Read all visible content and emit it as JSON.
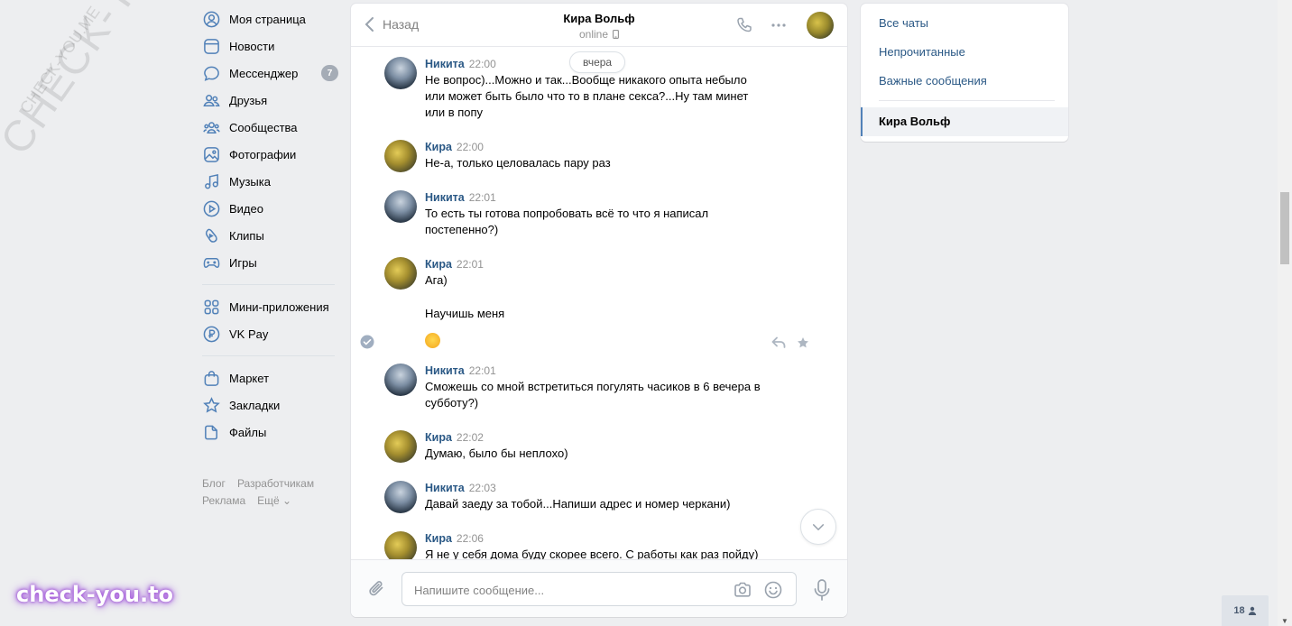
{
  "watermarks": {
    "big": "CHECK-YOU.ME",
    "small": "CHECK-YOU.ME",
    "bottom": "check-you.to"
  },
  "sidebar": {
    "items": [
      {
        "label": "Моя страница",
        "icon": "user-icon"
      },
      {
        "label": "Новости",
        "icon": "news-icon"
      },
      {
        "label": "Мессенджер",
        "icon": "messenger-icon",
        "badge": "7"
      },
      {
        "label": "Друзья",
        "icon": "friends-icon"
      },
      {
        "label": "Сообщества",
        "icon": "communities-icon"
      },
      {
        "label": "Фотографии",
        "icon": "photos-icon"
      },
      {
        "label": "Музыка",
        "icon": "music-icon"
      },
      {
        "label": "Видео",
        "icon": "video-icon"
      },
      {
        "label": "Клипы",
        "icon": "clips-icon"
      },
      {
        "label": "Игры",
        "icon": "games-icon"
      }
    ],
    "items2": [
      {
        "label": "Мини-приложения",
        "icon": "apps-icon"
      },
      {
        "label": "VK Pay",
        "icon": "vkpay-icon"
      }
    ],
    "items3": [
      {
        "label": "Маркет",
        "icon": "market-icon"
      },
      {
        "label": "Закладки",
        "icon": "bookmarks-icon"
      },
      {
        "label": "Файлы",
        "icon": "files-icon"
      }
    ],
    "footer": {
      "blog": "Блог",
      "developers": "Разработчикам",
      "ads": "Реклама",
      "more": "Ещё ⌄"
    }
  },
  "chat": {
    "back_label": "Назад",
    "peer_name": "Кира Вольф",
    "peer_status": "online",
    "day_label": "вчера",
    "messages": [
      {
        "author": "Никита",
        "time": "22:00",
        "text": [
          "Не вопрос)...Можно и так...Вообще никакого опыта небыло",
          "или может быть было что то в плане секса?...Ну там минет",
          "или в попу"
        ]
      },
      {
        "author": "Кира",
        "time": "22:00",
        "text": [
          "Не-а, только целовалась пару раз"
        ]
      },
      {
        "author": "Никита",
        "time": "22:01",
        "text": [
          "То есть ты готова попробовать всё то что я написал",
          "постепенно?)"
        ]
      },
      {
        "author": "Кира",
        "time": "22:01",
        "text": [
          "Ага)"
        ],
        "cont1": "Научишь меня"
      },
      {
        "author": "Никита",
        "time": "22:01",
        "text": [
          "Сможешь со мной встретиться погулять часиков в 6 вечера в",
          "субботу?)"
        ]
      },
      {
        "author": "Кира",
        "time": "22:02",
        "text": [
          "Думаю, было бы неплохо)"
        ]
      },
      {
        "author": "Никита",
        "time": "22:03",
        "text": [
          "Давай заеду за тобой...Напиши адрес и номер черкани)"
        ]
      },
      {
        "author": "Кира",
        "time": "22:06",
        "text": [
          "Я не у себя дома буду скорее всего. С работы как раз пойду)"
        ]
      }
    ],
    "composer_placeholder": "Напишите сообщение..."
  },
  "right_panel": {
    "all_chats": "Все чаты",
    "unread": "Непрочитанные",
    "important": "Важные сообщения",
    "active_chat": "Кира Вольф"
  },
  "counter": "18",
  "colors": {
    "background": "#edeef0",
    "link": "#2a5885",
    "accent": "#5181b8"
  }
}
